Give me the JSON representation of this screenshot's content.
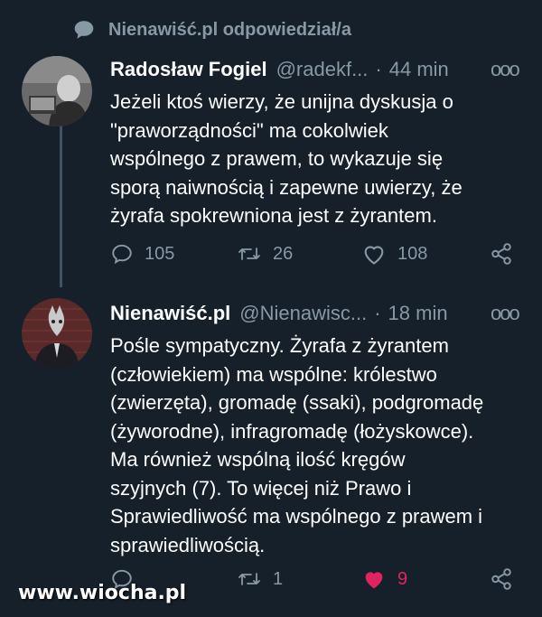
{
  "reply_context": {
    "text": "Nienawiść.pl odpowiedział/a",
    "icon": "speech-bubble-icon"
  },
  "tweet1": {
    "name": "Radosław Fogiel",
    "handle": "@radekf...",
    "separator": "·",
    "time": "44 min",
    "more": "ooo",
    "body": [
      "Jeżeli ktoś wierzy, że unijna dyskusja o",
      "\"praworządności\" ma cokolwiek",
      "wspólnego z prawem, to wykazuje się",
      "sporą naiwnością i zapewne uwierzy, że",
      "żyrafa spokrewniona jest z żyrantem."
    ],
    "replies": "105",
    "retweets": "26",
    "likes": "108"
  },
  "tweet2": {
    "name": "Nienawiść.pl",
    "handle": "@Nienawisc...",
    "separator": "·",
    "time": "18 min",
    "more": "ooo",
    "body": [
      "Pośle sympatyczny. Żyrafa z żyrantem",
      "(człowiekiem) ma wspólne: królestwo",
      "(zwierzęta), gromadę (ssaki), podgromadę",
      "(żyworodne), infragromadę (łożyskowce).",
      "Ma również wspólną ilość kręgów",
      "szyjnych (7). To więcej niż Prawo i",
      "Sprawiedliwość ma wspólnego z prawem i",
      "sprawiedliwością."
    ],
    "replies": "",
    "retweets": "1",
    "likes": "9",
    "liked_color": "#e0245e"
  },
  "watermark": "www.wiocha.pl",
  "colors": {
    "background": "#15202b",
    "muted": "#8899a6",
    "thread_line": "#3d5466",
    "like_active": "#e0245e"
  }
}
